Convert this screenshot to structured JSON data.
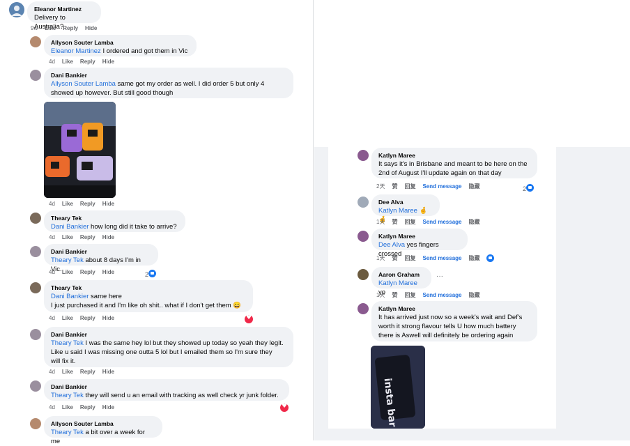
{
  "left": {
    "comments": [
      {
        "author": "Eleanor Martinez",
        "text": "Delivery to Australia?",
        "time": "9w",
        "like": "Like",
        "reply": "Reply",
        "hide": "Hide"
      },
      {
        "author": "Allyson Souter Lamba",
        "mention": "Eleanor Martinez",
        "text": " I ordered and got them in Vic",
        "time": "4d",
        "like": "Like",
        "reply": "Reply",
        "hide": "Hide"
      },
      {
        "author": "Dani Bankier",
        "mention": "Allyson Souter Lamba",
        "text": " same got my order as well. I did order 5 but only 4",
        "text2": "showed up however. But still good though",
        "time": "4d",
        "like": "Like",
        "reply": "Reply",
        "hide": "Hide"
      },
      {
        "author": "Theary Tek",
        "mention": "Dani Bankier",
        "text": " how long did it take to arrive?",
        "time": "4d",
        "like": "Like",
        "reply": "Reply",
        "hide": "Hide"
      },
      {
        "author": "Dani Bankier",
        "mention": "Theary Tek",
        "text": " about 8 days I'm in Vic.",
        "time": "4d",
        "like": "Like",
        "reply": "Reply",
        "hide": "Hide",
        "reactions": "2"
      },
      {
        "author": "Theary Tek",
        "mention": "Dani Bankier",
        "text": " same here",
        "text2": "I just purchased it and I'm like oh shit.. what if I don't get them 😄",
        "time": "4d",
        "like": "Like",
        "reply": "Reply",
        "hide": "Hide"
      },
      {
        "author": "Dani Bankier",
        "mention": "Theary Tek",
        "text": " I was the same hey lol but they showed up today so yeah they legit.",
        "text2": "Like u said I was missing one outta 5 lol but I emailed them so I'm sure they",
        "text3": "will fix it.",
        "time": "4d",
        "like": "Like",
        "reply": "Reply",
        "hide": "Hide"
      },
      {
        "author": "Dani Bankier",
        "mention": "Theary Tek",
        "text": " they will send u an email with tracking as well check yr junk folder.",
        "time": "4d",
        "like": "Like",
        "reply": "Reply",
        "hide": "Hide"
      },
      {
        "author": "Allyson Souter Lamba",
        "mention": "Theary Tek",
        "text": " a bit over a week for me"
      }
    ]
  },
  "right": {
    "comments": [
      {
        "author": "Katlyn Maree",
        "text": "It says it's in Brisbane and meant to be here on the",
        "text2": "2nd of August I'll update again on that day",
        "time": "2天",
        "like": "赞",
        "reply": "回复",
        "send": "Send message",
        "hide": "隐藏",
        "reactions": "2"
      },
      {
        "author": "Dee Alva",
        "mention": "Katlyn Maree",
        "text": " 🤞🤞",
        "time": "1天",
        "like": "赞",
        "reply": "回复",
        "send": "Send message",
        "hide": "隐藏"
      },
      {
        "author": "Katlyn Maree",
        "mention": "Dee Alva",
        "text": " yes fingers crossed",
        "time": "1天",
        "like": "赞",
        "reply": "回复",
        "send": "Send message",
        "hide": "隐藏"
      },
      {
        "author": "Aaron Graham",
        "mention": "Katlyn Maree",
        "text": " yo",
        "time": "1天",
        "like": "赞",
        "reply": "回复",
        "send": "Send message",
        "hide": "隐藏",
        "more": "···"
      },
      {
        "author": "Katlyn Maree",
        "text": "It has arrived just now so a week's wait and Def's",
        "text2": "worth it strong flavour tells U how much battery",
        "text3": "there is Aswell will definitely be ordering again"
      }
    ],
    "photo_text": "insta bar"
  },
  "colors": {
    "mention": "#216fdb",
    "bubble": "#f0f2f5",
    "meta": "#65676b"
  }
}
